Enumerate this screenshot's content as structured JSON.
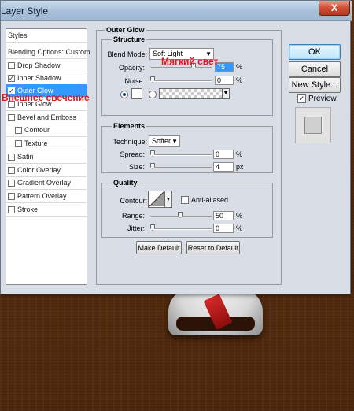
{
  "window": {
    "title": "Layer Style",
    "close_glyph": "X"
  },
  "styles_panel": {
    "items": [
      {
        "label": "Styles",
        "checkbox": false,
        "checked": false
      },
      {
        "label": "Blending Options: Custom",
        "checkbox": false,
        "checked": false
      },
      {
        "label": "Drop Shadow",
        "checkbox": true,
        "checked": false
      },
      {
        "label": "Inner Shadow",
        "checkbox": true,
        "checked": true
      },
      {
        "label": "Outer Glow",
        "checkbox": true,
        "checked": true
      },
      {
        "label": "Inner Glow",
        "checkbox": true,
        "checked": false
      },
      {
        "label": "Bevel and Emboss",
        "checkbox": true,
        "checked": false
      },
      {
        "label": "Contour",
        "checkbox": true,
        "checked": false
      },
      {
        "label": "Texture",
        "checkbox": true,
        "checked": false
      },
      {
        "label": "Satin",
        "checkbox": true,
        "checked": false
      },
      {
        "label": "Color Overlay",
        "checkbox": true,
        "checked": false
      },
      {
        "label": "Gradient Overlay",
        "checkbox": true,
        "checked": false
      },
      {
        "label": "Pattern Overlay",
        "checkbox": true,
        "checked": false
      },
      {
        "label": "Stroke",
        "checkbox": true,
        "checked": false
      }
    ],
    "selected": "Outer Glow"
  },
  "outer_glow": {
    "title": "Outer Glow",
    "structure": {
      "legend": "Structure",
      "blend_mode_label": "Blend Mode:",
      "blend_mode_value": "Soft Light",
      "opacity_label": "Opacity:",
      "opacity_value": "75",
      "opacity_unit": "%",
      "noise_label": "Noise:",
      "noise_value": "0",
      "noise_unit": "%"
    },
    "elements": {
      "legend": "Elements",
      "technique_label": "Technique:",
      "technique_value": "Softer",
      "spread_label": "Spread:",
      "spread_value": "0",
      "spread_unit": "%",
      "size_label": "Size:",
      "size_value": "4",
      "size_unit": "px"
    },
    "quality": {
      "legend": "Quality",
      "contour_label": "Contour:",
      "anti_aliased_label": "Anti-aliased",
      "range_label": "Range:",
      "range_value": "50",
      "range_unit": "%",
      "jitter_label": "Jitter:",
      "jitter_value": "0",
      "jitter_unit": "%"
    },
    "make_default": "Make Default",
    "reset_default": "Reset to Default"
  },
  "right_panel": {
    "ok": "OK",
    "cancel": "Cancel",
    "new_style": "New Style...",
    "preview": "Preview"
  },
  "annotations": {
    "soft_light_ru": "Мягкий свет",
    "outer_glow_ru": "Внешнее свечение"
  }
}
